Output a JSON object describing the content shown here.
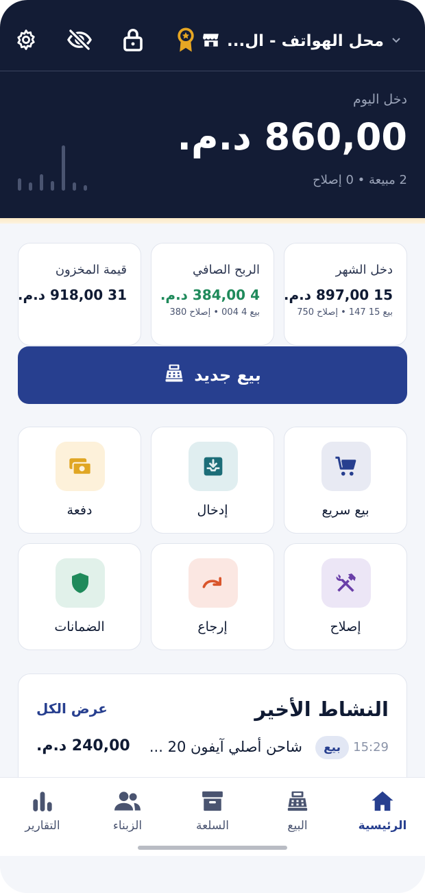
{
  "header": {
    "store_name": "محل الهواتف - ال...",
    "icons": [
      "settings-icon",
      "visibility-off-icon",
      "lock-icon",
      "premium-badge-icon",
      "chevron-down-icon",
      "store-icon"
    ]
  },
  "today": {
    "label": "دخل اليوم",
    "amount": "860,00 د.م.",
    "sub": "2 مبيعة • 0 إصلاح"
  },
  "stats": [
    {
      "title": "دخل الشهر",
      "value": "15 897,00 د.م.",
      "sub": "بيع 15 147 • إصلاح 750"
    },
    {
      "title": "الربح الصافي",
      "value": "4 384,00 د.م.",
      "sub": "بيع 4 004 • إصلاح 380",
      "value_color": "#1f8a5b"
    },
    {
      "title": "قيمة المخزون",
      "value": "31 918,00 د.م.",
      "sub": ""
    }
  ],
  "new_sale": {
    "label": "بيع جديد",
    "icon": "cash-register-icon"
  },
  "actions": [
    {
      "label": "بيع سريع",
      "icon": "cart-icon",
      "bg": "#e8eaf3",
      "fg": "#273f8f"
    },
    {
      "label": "إدخال",
      "icon": "inbox-download-icon",
      "bg": "#e0eef0",
      "fg": "#1c6d78"
    },
    {
      "label": "دفعة",
      "icon": "cash-icon",
      "bg": "#fdf1da",
      "fg": "#e0a623"
    },
    {
      "label": "إصلاح",
      "icon": "tools-icon",
      "bg": "#ece6f6",
      "fg": "#6a3fa8"
    },
    {
      "label": "إرجاع",
      "icon": "return-arrow-icon",
      "bg": "#fbe7e2",
      "fg": "#d9552b"
    },
    {
      "label": "الضمانات",
      "icon": "shield-icon",
      "bg": "#e1f1ea",
      "fg": "#1f8a5b"
    }
  ],
  "activity": {
    "title": "النشاط الأخير",
    "view_all": "عرض الكل",
    "items": [
      {
        "time": "15:29",
        "type": "بيع",
        "description": "شاحن أصلي آيفون 20 ...",
        "amount": "240,00 د.م."
      }
    ]
  },
  "nav": [
    {
      "label": "الرئيسية",
      "icon": "home-icon",
      "active": true
    },
    {
      "label": "البيع",
      "icon": "cash-register-icon",
      "active": false
    },
    {
      "label": "السلعة",
      "icon": "archive-box-icon",
      "active": false
    },
    {
      "label": "الزبناء",
      "icon": "users-icon",
      "active": false
    },
    {
      "label": "التقارير",
      "icon": "bar-chart-icon",
      "active": false
    }
  ],
  "colors": {
    "header_bg": "#131c35",
    "primary": "#273f8f",
    "profit_green": "#1f8a5b",
    "badge_gold": "#e6a623"
  }
}
